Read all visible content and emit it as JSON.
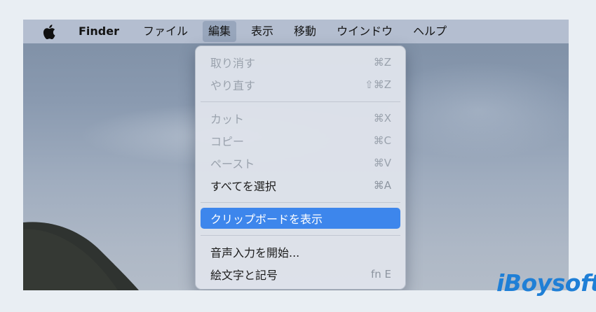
{
  "menubar": {
    "items": [
      {
        "label": "Finder"
      },
      {
        "label": "ファイル"
      },
      {
        "label": "編集"
      },
      {
        "label": "表示"
      },
      {
        "label": "移動"
      },
      {
        "label": "ウインドウ"
      },
      {
        "label": "ヘルプ"
      }
    ],
    "active_index": 2
  },
  "edit_menu": {
    "items": [
      {
        "label": "取り消す",
        "shortcut": "⌘Z",
        "enabled": false
      },
      {
        "label": "やり直す",
        "shortcut": "⇧⌘Z",
        "enabled": false
      },
      {
        "label": "カット",
        "shortcut": "⌘X",
        "enabled": false
      },
      {
        "label": "コピー",
        "shortcut": "⌘C",
        "enabled": false
      },
      {
        "label": "ペースト",
        "shortcut": "⌘V",
        "enabled": false
      },
      {
        "label": "すべてを選択",
        "shortcut": "⌘A",
        "enabled": true
      },
      {
        "label": "クリップボードを表示",
        "shortcut": "",
        "enabled": true,
        "highlighted": true
      },
      {
        "label": "音声入力を開始...",
        "shortcut": "",
        "enabled": true
      },
      {
        "label": "絵文字と記号",
        "shortcut": "fn E",
        "enabled": true
      }
    ]
  },
  "watermark": {
    "text": "iBoysoft"
  },
  "colors": {
    "highlight": "#3d86ec",
    "menubar": "#b4bed0",
    "brand": "#1f7fd6"
  },
  "icons": {
    "apple": "apple-logo-icon"
  }
}
